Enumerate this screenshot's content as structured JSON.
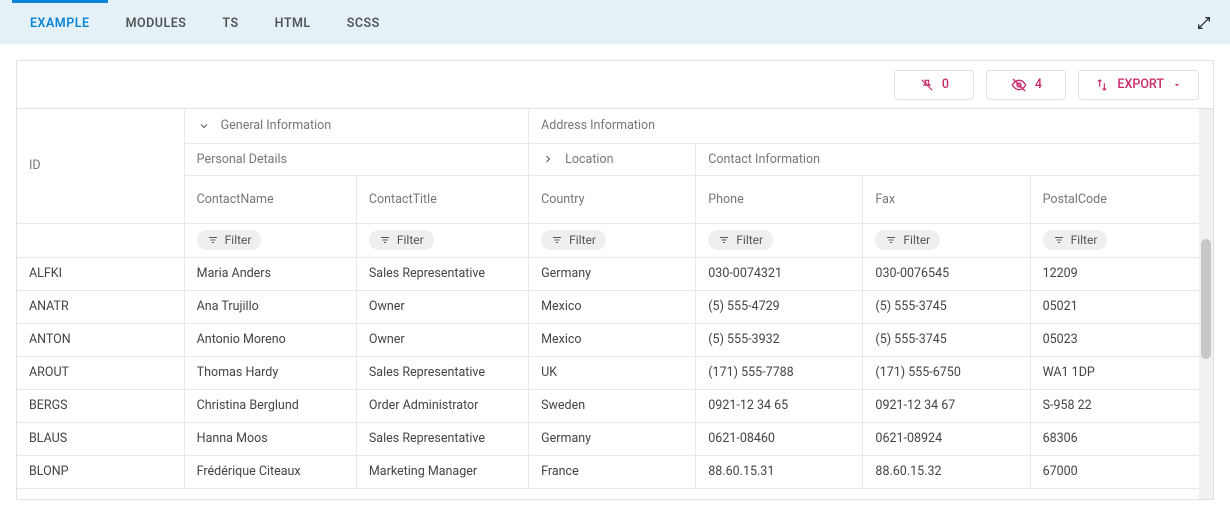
{
  "tabs": [
    {
      "label": "EXAMPLE",
      "active": true
    },
    {
      "label": "MODULES",
      "active": false
    },
    {
      "label": "TS",
      "active": false
    },
    {
      "label": "HTML",
      "active": false
    },
    {
      "label": "SCSS",
      "active": false
    }
  ],
  "toolbar": {
    "pinned_count": "0",
    "hidden_count": "4",
    "export_label": "EXPORT"
  },
  "grid": {
    "groups": {
      "general": "General Information",
      "address": "Address Information"
    },
    "subgroups": {
      "personal": "Personal Details",
      "location": "Location",
      "contact": "Contact Information"
    },
    "columns": [
      "ID",
      "ContactName",
      "ContactTitle",
      "Country",
      "Phone",
      "Fax",
      "PostalCode"
    ],
    "filter_label": "Filter",
    "rows": [
      {
        "id": "ALFKI",
        "name": "Maria Anders",
        "title": "Sales Representative",
        "country": "Germany",
        "phone": "030-0074321",
        "fax": "030-0076545",
        "postal": "12209"
      },
      {
        "id": "ANATR",
        "name": "Ana Trujillo",
        "title": "Owner",
        "country": "Mexico",
        "phone": "(5) 555-4729",
        "fax": "(5) 555-3745",
        "postal": "05021"
      },
      {
        "id": "ANTON",
        "name": "Antonio Moreno",
        "title": "Owner",
        "country": "Mexico",
        "phone": "(5) 555-3932",
        "fax": "(5) 555-3745",
        "postal": "05023"
      },
      {
        "id": "AROUT",
        "name": "Thomas Hardy",
        "title": "Sales Representative",
        "country": "UK",
        "phone": "(171) 555-7788",
        "fax": "(171) 555-6750",
        "postal": "WA1 1DP"
      },
      {
        "id": "BERGS",
        "name": "Christina Berglund",
        "title": "Order Administrator",
        "country": "Sweden",
        "phone": "0921-12 34 65",
        "fax": "0921-12 34 67",
        "postal": "S-958 22"
      },
      {
        "id": "BLAUS",
        "name": "Hanna Moos",
        "title": "Sales Representative",
        "country": "Germany",
        "phone": "0621-08460",
        "fax": "0621-08924",
        "postal": "68306"
      },
      {
        "id": "BLONP",
        "name": "Frédérique Citeaux",
        "title": "Marketing Manager",
        "country": "France",
        "phone": "88.60.15.31",
        "fax": "88.60.15.32",
        "postal": "67000"
      }
    ]
  }
}
